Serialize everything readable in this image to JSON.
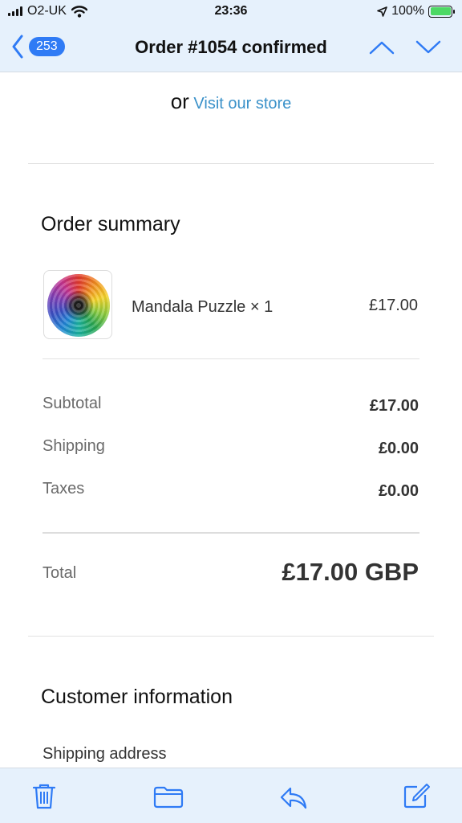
{
  "status_bar": {
    "carrier": "O2-UK",
    "time": "23:36",
    "battery": "100%",
    "icons": [
      "signal-bars-icon",
      "wifi-icon",
      "location-arrow-icon",
      "battery-charging-icon"
    ]
  },
  "nav": {
    "back_count": "253",
    "title": "Order #1054 confirmed",
    "icons": [
      "back-chevron-icon",
      "previous-message-icon",
      "next-message-icon"
    ]
  },
  "store": {
    "or": "or",
    "link": "Visit our store"
  },
  "order_summary": {
    "title": "Order summary",
    "item": {
      "name": "Mandala Puzzle × 1",
      "price": "£17.00",
      "image": "mandala-puzzle-thumbnail"
    },
    "rows": [
      {
        "label": "Subtotal",
        "value": "£17.00"
      },
      {
        "label": "Shipping",
        "value": "£0.00"
      },
      {
        "label": "Taxes",
        "value": "£0.00"
      }
    ],
    "total_label": "Total",
    "total_value": "£17.00 GBP"
  },
  "customer_info": {
    "title": "Customer information",
    "shipping_address_label": "Shipping address"
  },
  "toolbar": {
    "icons": [
      "trash-icon",
      "folder-icon",
      "reply-icon",
      "compose-icon"
    ]
  },
  "colors": {
    "bar_background": "#e6f1fc",
    "accent_blue": "#2f7bf5",
    "link_blue": "#3a91c9",
    "battery_green": "#4cd964"
  }
}
